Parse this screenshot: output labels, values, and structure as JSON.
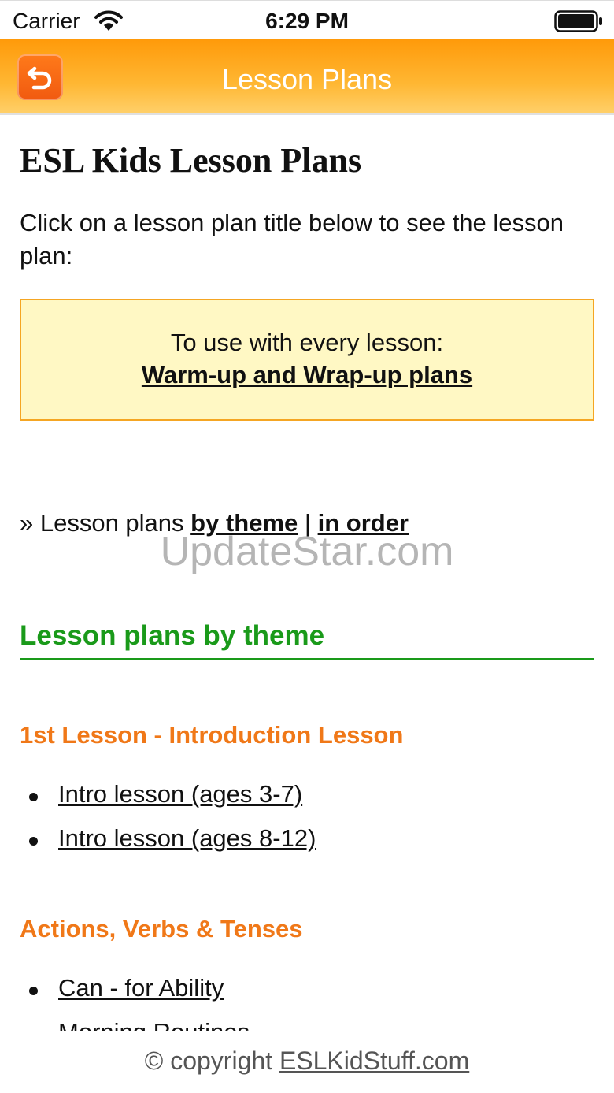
{
  "status_bar": {
    "carrier": "Carrier",
    "time": "6:29 PM"
  },
  "nav": {
    "title": "Lesson Plans",
    "back_icon": "return-arrow-icon"
  },
  "page": {
    "title": "ESL Kids Lesson Plans",
    "intro": "Click on a lesson plan title below to see the lesson plan:"
  },
  "callout": {
    "text": "To use with every lesson:",
    "link": "Warm-up and Wrap-up plans"
  },
  "plan_links": {
    "prefix": "» Lesson plans",
    "by_theme": "by theme",
    "separator": "|",
    "in_order": "in order"
  },
  "watermark": "UpdateStar.com",
  "section": {
    "heading": "Lesson plans by theme",
    "groups": [
      {
        "title": "1st Lesson - Introduction Lesson",
        "items": [
          "Intro lesson (ages 3-7)",
          "Intro lesson (ages 8-12)"
        ]
      },
      {
        "title": "Actions, Verbs & Tenses",
        "items": [
          "Can - for Ability",
          "Morning Routines"
        ]
      }
    ]
  },
  "footer": {
    "prefix": "© copyright",
    "link": "ESLKidStuff.com"
  },
  "colors": {
    "nav_orange": "#ff9a0a",
    "heading_green": "#1a9a1a",
    "subheading_orange": "#f07818",
    "callout_bg": "#fff8c4",
    "callout_border": "#f5a623"
  }
}
